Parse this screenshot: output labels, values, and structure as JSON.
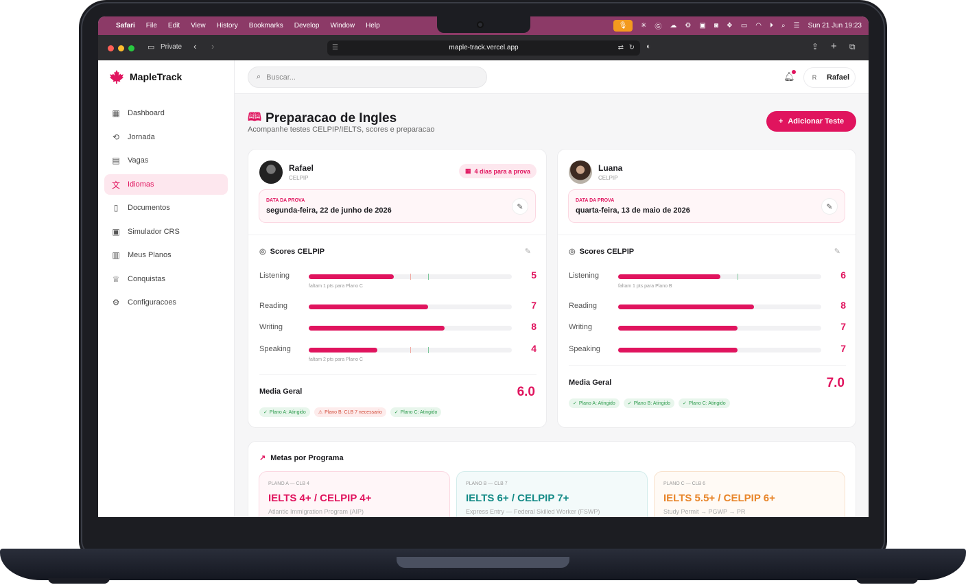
{
  "menubar": {
    "app": "Safari",
    "menus": [
      "File",
      "Edit",
      "View",
      "History",
      "Bookmarks",
      "Develop",
      "Window",
      "Help"
    ],
    "clock": "Sun 21 Jun  19:23"
  },
  "browser": {
    "mode": "Private",
    "url": "maple-track.vercel.app"
  },
  "app": {
    "name": "MapleTrack"
  },
  "sidebar": {
    "items": [
      {
        "label": "Dashboard",
        "icon": "dashboard-icon"
      },
      {
        "label": "Jornada",
        "icon": "route-icon"
      },
      {
        "label": "Vagas",
        "icon": "briefcase-icon"
      },
      {
        "label": "Idiomas",
        "icon": "languages-icon",
        "active": true
      },
      {
        "label": "Documentos",
        "icon": "document-icon"
      },
      {
        "label": "Simulador CRS",
        "icon": "calculator-icon"
      },
      {
        "label": "Meus Planos",
        "icon": "map-icon"
      },
      {
        "label": "Conquistas",
        "icon": "trophy-icon"
      },
      {
        "label": "Configuracoes",
        "icon": "gear-icon"
      }
    ]
  },
  "topbar": {
    "search_placeholder": "Buscar...",
    "user_initial": "R",
    "user_name": "Rafael"
  },
  "page": {
    "title": "Preparacao de Ingles",
    "subtitle": "Acompanhe testes CELPIP/IELTS, scores e preparacao",
    "add_button": "Adicionar Teste"
  },
  "profiles": [
    {
      "name": "Rafael",
      "test": "CELPIP",
      "countdown": "4 dias para a prova",
      "date_label": "DATA DA PROVA",
      "date": "segunda-feira, 22 de junho de 2026",
      "scores_title": "Scores CELPIP",
      "scores": [
        {
          "skill": "Listening",
          "score": "5",
          "note": "faltam 1 pts para Plano C"
        },
        {
          "skill": "Reading",
          "score": "7",
          "note": ""
        },
        {
          "skill": "Writing",
          "score": "8",
          "note": ""
        },
        {
          "skill": "Speaking",
          "score": "4",
          "note": "faltam 2 pts para Plano C"
        }
      ],
      "media_label": "Media Geral",
      "media": "6.0",
      "badges": [
        {
          "text": "Plano A: Atingido",
          "status": "ok"
        },
        {
          "text": "Plano B: CLB 7 necessario",
          "status": "warn"
        },
        {
          "text": "Plano C: Atingido",
          "status": "ok"
        }
      ]
    },
    {
      "name": "Luana",
      "test": "CELPIP",
      "date_label": "DATA DA PROVA",
      "date": "quarta-feira, 13 de maio de 2026",
      "scores_title": "Scores CELPIP",
      "scores": [
        {
          "skill": "Listening",
          "score": "6",
          "note": "faltam 1 pts para Plano B"
        },
        {
          "skill": "Reading",
          "score": "8",
          "note": ""
        },
        {
          "skill": "Writing",
          "score": "7",
          "note": ""
        },
        {
          "skill": "Speaking",
          "score": "7",
          "note": ""
        }
      ],
      "media_label": "Media Geral",
      "media": "7.0",
      "badges": [
        {
          "text": "Plano A: Atingido",
          "status": "ok"
        },
        {
          "text": "Plano B: Atingido",
          "status": "ok"
        },
        {
          "text": "Plano C: Atingido",
          "status": "ok"
        }
      ]
    }
  ],
  "metas": {
    "title": "Metas por Programa",
    "plans": [
      {
        "label": "PLANO A — CLB 4",
        "target": "IELTS 4+ / CELPIP 4+",
        "program": "Atlantic Immigration Program (AIP)",
        "color": "#e0145e"
      },
      {
        "label": "PLANO B — CLB 7",
        "target": "IELTS 6+ / CELPIP 7+",
        "program": "Express Entry — Federal Skilled Worker (FSWP)",
        "color": "#138a86"
      },
      {
        "label": "PLANO C — CLB 6",
        "target": "IELTS 5.5+ / CELPIP 6+",
        "program": "Study Permit → PGWP → PR",
        "color": "#e8852a"
      }
    ]
  },
  "colors": {
    "accent": "#e0145e",
    "menubar": "#8c3a67",
    "ok": "#2c9a4c",
    "warn": "#d24c3a"
  }
}
